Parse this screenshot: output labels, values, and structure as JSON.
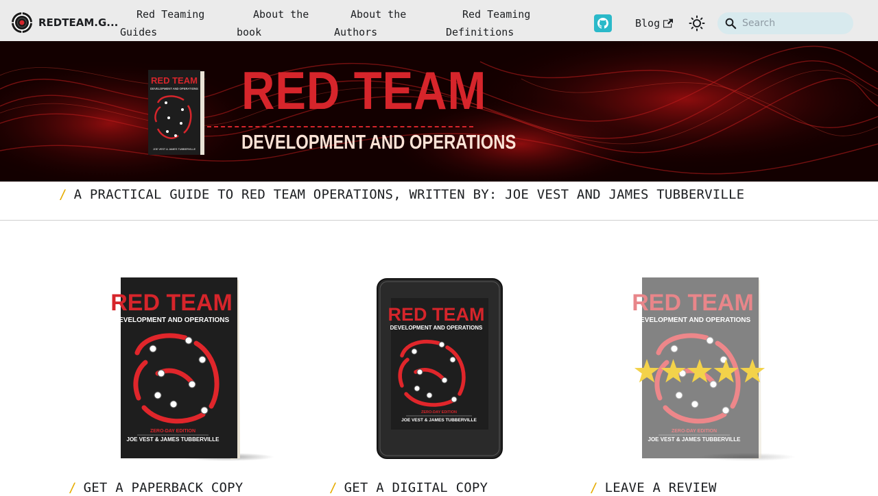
{
  "navbar": {
    "brand_title": "REDTEAM.G...",
    "links": [
      {
        "line1": "Red Teaming",
        "line2": "Guides"
      },
      {
        "line1": "About the",
        "line2": "book"
      },
      {
        "line1": "About the",
        "line2": "Authors"
      },
      {
        "line1": "Red Teaming",
        "line2": "Definitions"
      }
    ],
    "github_icon": "github-icon",
    "blog_label": "Blog",
    "theme_icon": "sun-icon",
    "search_placeholder": "Search"
  },
  "hero": {
    "title": "RED TEAM",
    "subtitle": "DEVELOPMENT AND OPERATIONS",
    "book_title": "RED TEAM",
    "book_subtitle": "DEVELOPMENT AND OPERATIONS",
    "book_authors": "JOE VEST & JAMES TUBBERVILLE"
  },
  "tagline": "A PRACTICAL GUIDE TO RED TEAM OPERATIONS, WRITTEN BY: JOE VEST AND JAMES TUBBERVILLE",
  "cards": [
    {
      "label": "GET A PAPERBACK COPY",
      "book_title": "RED TEAM",
      "book_subtitle": "DEVELOPMENT AND OPERATIONS",
      "edition": "ZERO-DAY EDITION",
      "authors": "JOE VEST & JAMES TUBBERVILLE"
    },
    {
      "label": "GET A DIGITAL COPY",
      "book_title": "RED TEAM",
      "book_subtitle": "DEVELOPMENT AND OPERATIONS",
      "edition": "ZERO-DAY EDITION",
      "authors": "JOE VEST & JAMES TUBBERVILLE"
    },
    {
      "label": "LEAVE A REVIEW",
      "book_title": "RED TEAM",
      "book_subtitle": "DEVELOPMENT AND OPERATIONS",
      "edition": "ZERO-DAY EDITION",
      "authors": "JOE VEST & JAMES TUBBERVILLE",
      "rating": 5,
      "rating_max": 5
    }
  ],
  "colors": {
    "accent_red": "#d6252b",
    "slash_yellow": "#e6ac00",
    "github_teal": "#2bb9c9",
    "star_yellow": "#f3d24a"
  }
}
